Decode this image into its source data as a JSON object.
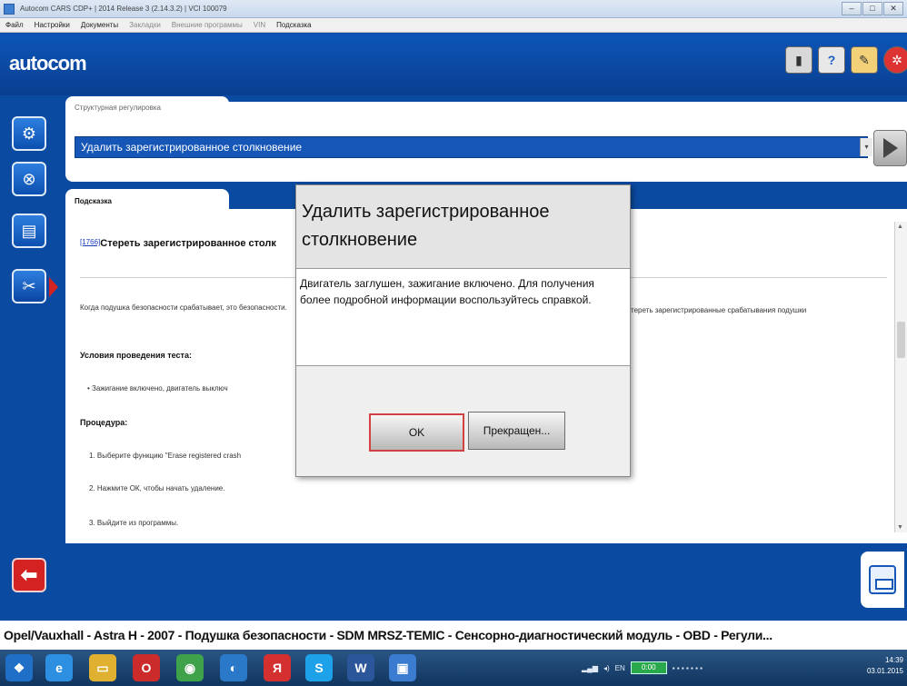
{
  "window": {
    "title": "Autocom CARS CDP+ | 2014 Release 3 (2.14.3.2) | VCI 100079",
    "controls": [
      "–",
      "□",
      "✕"
    ]
  },
  "menu": {
    "items": [
      "Файл",
      "Настройки",
      "Документы",
      "Закладки",
      "Внешние программы",
      "VIN",
      "Подсказка"
    ]
  },
  "header": {
    "logo": "autocom",
    "icons": [
      "battery-icon",
      "help-icon",
      "notes-icon",
      "settings-icon"
    ]
  },
  "sidebar": {
    "items": [
      {
        "name": "ecu-icon",
        "glyph": "⚙"
      },
      {
        "name": "diagnostics-icon",
        "glyph": "⊗"
      },
      {
        "name": "document-icon",
        "glyph": "▤"
      },
      {
        "name": "tools-icon",
        "glyph": "✂"
      }
    ],
    "active_index": 3,
    "back_glyph": "⬅"
  },
  "top_panel": {
    "tab_label": "Структурная регулировка",
    "selected_function": "Удалить зарегистрированное столкновение"
  },
  "help": {
    "tab_label": "Подсказка",
    "ref": "[1766]",
    "heading": "Стереть зарегистрированное столк",
    "para_left": "Когда подушка безопасности срабатывает, это безопасности.",
    "para_right": "стереть зарегистрированные срабатывания подушки",
    "conditions_title": "Условия проведения теста:",
    "conditions_item": "Зажигание включено, двигатель выключ",
    "procedure_title": "Процедура:",
    "steps": [
      "1.  Выберите функцию \"Erase registered crash",
      "2.  Нажмите ОК, чтобы начать удаление.",
      "3.  Выйдите из программы."
    ]
  },
  "dialog": {
    "title": "Удалить зарегистрированное столкновение",
    "message": "Двигатель заглушен, зажигание включено. Для получения более подробной информации воспользуйтесь справкой.",
    "ok_label": "OK",
    "cancel_label": "Прекращен..."
  },
  "status": {
    "text": "Opel/Vauxhall - Astra H - 2007 - Подушка безопасности - SDM MRSZ-TEMIC - Сенсорно-диагностический модуль - OBD - Регули..."
  },
  "taskbar": {
    "apps": [
      {
        "name": "start-button",
        "glyph": "❖",
        "color": "#1f6fc6"
      },
      {
        "name": "ie-icon",
        "glyph": "e",
        "color": "#2d8fe0"
      },
      {
        "name": "explorer-icon",
        "glyph": "▭",
        "color": "#e0b030"
      },
      {
        "name": "opera-icon",
        "glyph": "O",
        "color": "#cc2b2b"
      },
      {
        "name": "chrome-icon",
        "glyph": "◉",
        "color": "#3da24a"
      },
      {
        "name": "media-icon",
        "glyph": "◐",
        "color": "#2a78c8"
      },
      {
        "name": "yandex-icon",
        "glyph": "Я",
        "color": "#d43030"
      },
      {
        "name": "skype-icon",
        "glyph": "S",
        "color": "#1da1e8"
      },
      {
        "name": "word-icon",
        "glyph": "W",
        "color": "#2b579a"
      },
      {
        "name": "autocom-task-icon",
        "glyph": "▣",
        "color": "#3b7bd0"
      }
    ],
    "tray_lang": "EN",
    "tray_chip": "0:00",
    "clock_time": "14:39",
    "clock_date": "03.01.2015"
  }
}
